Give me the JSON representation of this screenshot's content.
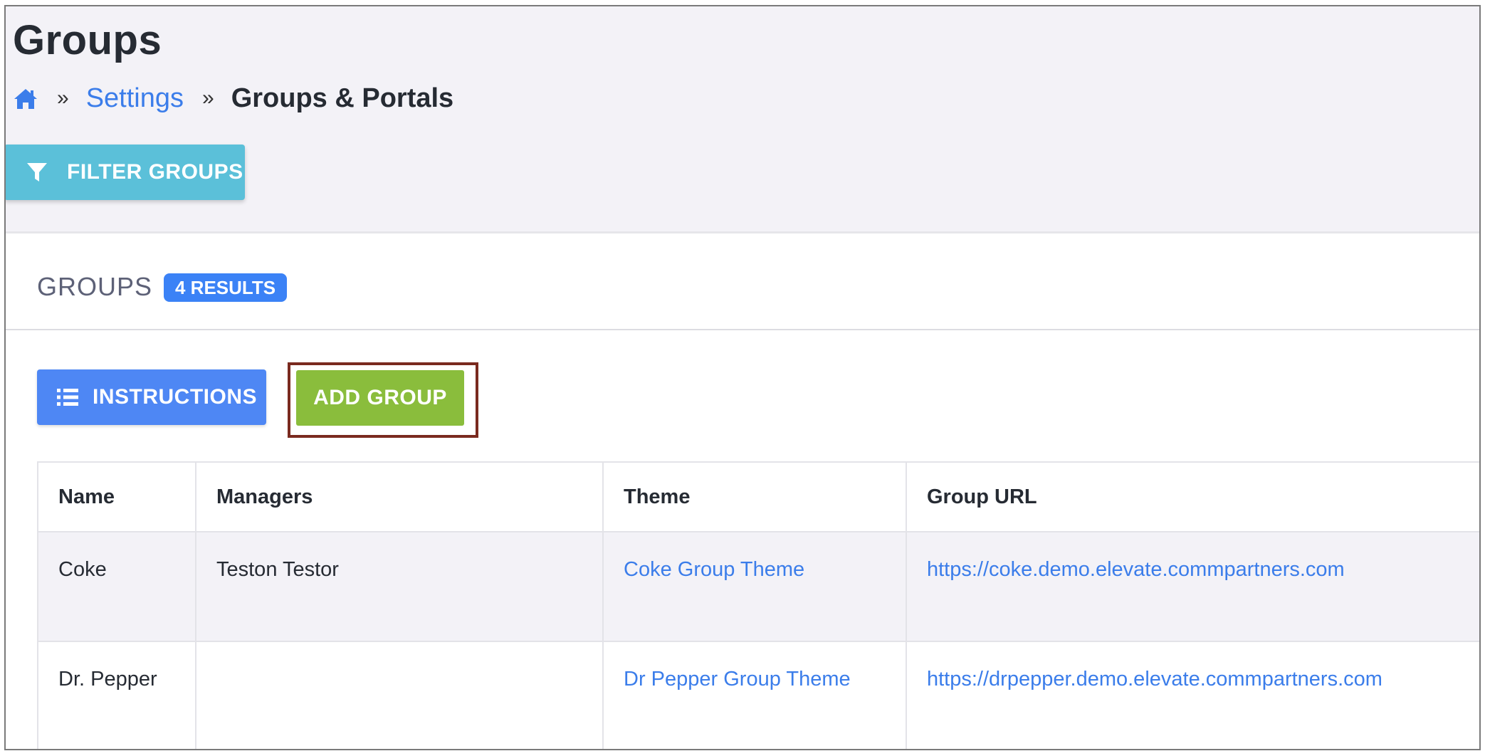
{
  "header": {
    "title": "Groups"
  },
  "breadcrumb": {
    "home_icon": "home-icon",
    "separator": "»",
    "items": [
      "Settings",
      "Groups & Portals"
    ]
  },
  "filter": {
    "label": "FILTER GROUPS",
    "icon": "filter-icon"
  },
  "panel": {
    "title": "GROUPS",
    "badge": "4 RESULTS"
  },
  "toolbar": {
    "instructions_label": "INSTRUCTIONS",
    "instructions_icon": "list-icon",
    "add_group_label": "ADD GROUP"
  },
  "table": {
    "columns": [
      "Name",
      "Managers",
      "Theme",
      "Group URL"
    ],
    "rows": [
      {
        "name": "Coke",
        "managers": "Teston Testor",
        "theme": "Coke Group Theme",
        "url": "https://coke.demo.elevate.commpartners.com"
      },
      {
        "name": "Dr. Pepper",
        "managers": "",
        "theme": "Dr Pepper Group Theme",
        "url": "https://drpepper.demo.elevate.commpartners.com"
      }
    ]
  },
  "colors": {
    "accent_blue": "#3b82f6",
    "filter_teal": "#5bc0d9",
    "add_green": "#8abd3c",
    "highlight_border": "#7a2a1f"
  }
}
